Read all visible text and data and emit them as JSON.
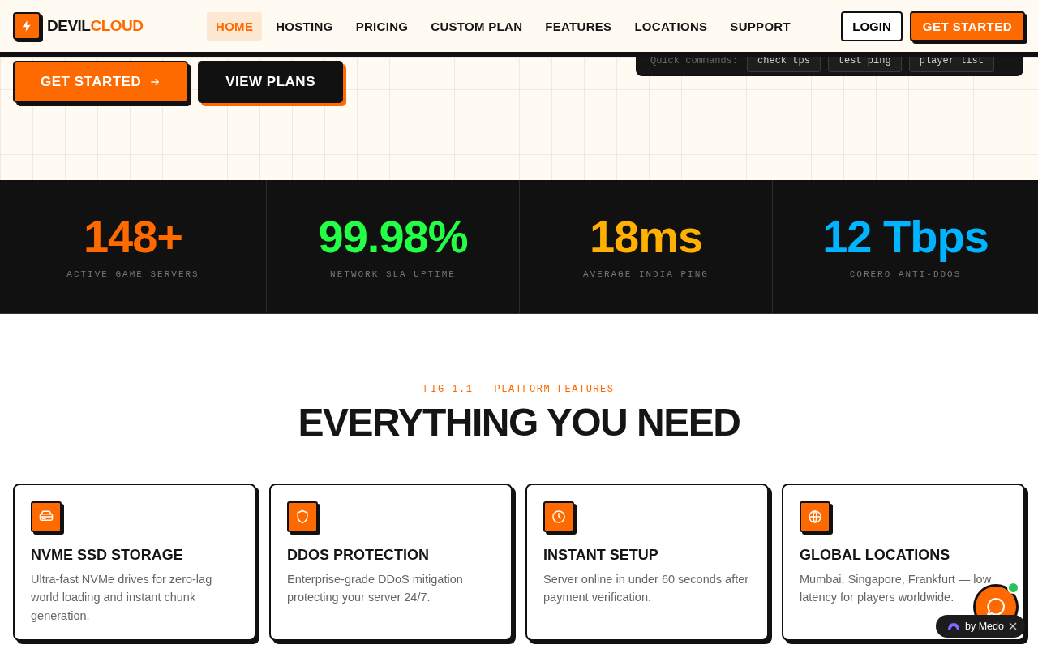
{
  "brand": {
    "part_1": "DEVIL",
    "part_2": "CLOUD"
  },
  "nav": [
    {
      "label": "HOME",
      "selected": true
    },
    {
      "label": "HOSTING",
      "selected": false
    },
    {
      "label": "PRICING",
      "selected": false
    },
    {
      "label": "CUSTOM PLAN",
      "selected": false
    },
    {
      "label": "FEATURES",
      "selected": false
    },
    {
      "label": "LOCATIONS",
      "selected": false
    },
    {
      "label": "SUPPORT",
      "selected": false
    }
  ],
  "header_buttons": {
    "login": "LOGIN",
    "get_started": "GET STARTED"
  },
  "hero": {
    "primary_button": "GET STARTED",
    "secondary_button": "VIEW PLANS",
    "terminal": {
      "label": "Quick commands:",
      "chips": [
        "check tps",
        "test ping",
        "player list"
      ]
    }
  },
  "stats": [
    {
      "value": "148+",
      "label": "ACTIVE GAME SERVERS",
      "color": "#ff6a00"
    },
    {
      "value": "99.98%",
      "label": "NETWORK SLA UPTIME",
      "color": "#22ff44"
    },
    {
      "value": "18ms",
      "label": "AVERAGE INDIA PING",
      "color": "#ffb000"
    },
    {
      "value": "12 Tbps",
      "label": "CORERO ANTI-DDOS",
      "color": "#00b4ff"
    }
  ],
  "features": {
    "eyebrow": "FIG 1.1 — PLATFORM FEATURES",
    "title": "EVERYTHING YOU NEED",
    "cards": [
      {
        "kind": "drive",
        "title": "NVME SSD STORAGE",
        "text": "Ultra-fast NVMe drives for zero-lag world loading and instant chunk generation."
      },
      {
        "kind": "shield",
        "title": "DDOS PROTECTION",
        "text": "Enterprise-grade DDoS mitigation protecting your server 24/7."
      },
      {
        "kind": "clock",
        "title": "INSTANT SETUP",
        "text": "Server online in under 60 seconds after payment verification."
      },
      {
        "kind": "globe",
        "title": "GLOBAL LOCATIONS",
        "text": "Mumbai, Singapore, Frankfurt — low latency for players worldwide."
      }
    ]
  },
  "badge": {
    "label": "by Medo"
  }
}
